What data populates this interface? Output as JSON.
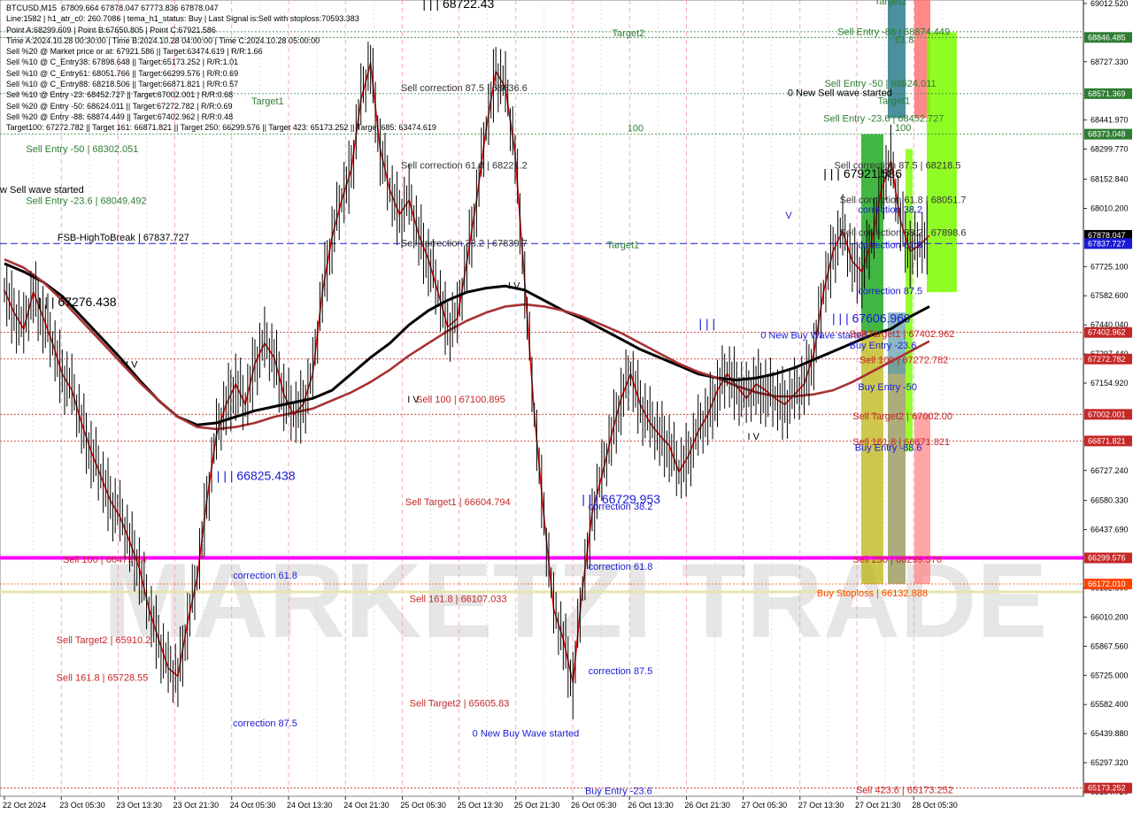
{
  "chart_data": {
    "type": "candlestick",
    "symbol": "BTCUSD,M15",
    "info_lines": [
      "BTCUSD,M15  67809.664 67878.047 67773.836 67878.047",
      "Line:1582 | h1_atr_c0: 260.7086 | tema_h1_status: Buy | Last Signal is:Sell with stoploss:70593.383",
      "Point A:68299.609 | Point B:67650.805 | Point C:67921.586",
      "Time A:2024.10.28 00:30:00 | Time B:2024.10.28 04:00:00 | Time C:2024.10.28 05:00:00",
      "Sell %20 @ Market price or at: 67921.586 || Target:63474.619 | R/R:1.66",
      "Sell %10 @ C_Entry38: 67898.648 || Target:65173.252 | R/R:1.01",
      "Sell %10 @ C_Entry61: 68051.766 || Target:66299.576 | R/R:0.69",
      "Sell %10 @ C_Entry88: 68218.506 || Target:66871.821 | R/R:0.57",
      "Sell %10 @ Entry -23: 68452.727 || Target:67002.001 | R/R:0.68",
      "Sell %20 @ Entry -50: 68624.011 || Target:67272.782 | R/R:0.69",
      "Sell %20 @ Entry -88: 68874.449 || Target:67402.962 | R/R:0.48",
      "Target100: 67272.782 || Target 161: 66871.821 || Target 250: 66299.576 || Target 423: 65173.252 || Target 685: 63474.619"
    ],
    "y_ticks": [
      "69012.520",
      "68727.330",
      "68441.970",
      "68299.770",
      "68152.840",
      "68010.200",
      "67725.100",
      "67582.600",
      "67440.040",
      "67297.440",
      "67154.920",
      "66869.240",
      "66727.240",
      "66580.330",
      "66437.690",
      "66152.800",
      "66010.200",
      "65867.560",
      "65725.000",
      "65582.400",
      "65439.880",
      "65297.320",
      "65154.720"
    ],
    "ylim": [
      65132.95,
      69029.62
    ],
    "x_ticks": [
      "22 Oct 2024",
      "23 Oct 05:30",
      "23 Oct 13:30",
      "23 Oct 21:30",
      "24 Oct 05:30",
      "24 Oct 13:30",
      "24 Oct 21:30",
      "25 Oct 05:30",
      "25 Oct 13:30",
      "25 Oct 21:30",
      "26 Oct 05:30",
      "26 Oct 13:30",
      "26 Oct 21:30",
      "27 Oct 05:30",
      "27 Oct 13:30",
      "27 Oct 21:30",
      "28 Oct 05:30"
    ],
    "price_tags": [
      {
        "label": "68846.485",
        "value": 68846.485,
        "color": "#2e7d32"
      },
      {
        "label": "68571.369",
        "value": 68571.369,
        "color": "#2e7d32"
      },
      {
        "label": "68373.048",
        "value": 68373.048,
        "color": "#2e7d32"
      },
      {
        "label": "67878.047",
        "value": 67878.047,
        "color": "#000000"
      },
      {
        "label": "67837.727",
        "value": 67837.727,
        "color": "#1a1ad6"
      },
      {
        "label": "67402.962",
        "value": 67402.962,
        "color": "#c62828"
      },
      {
        "label": "67272.782",
        "value": 67272.782,
        "color": "#c62828"
      },
      {
        "label": "67002.001",
        "value": 67002.001,
        "color": "#c62828"
      },
      {
        "label": "66871.821",
        "value": 66871.821,
        "color": "#c62828"
      },
      {
        "label": "66299.576",
        "value": 66299.576,
        "color": "#c62828"
      },
      {
        "label": "66172.010",
        "value": 66172.01,
        "color": "#ff4500"
      },
      {
        "label": "65173.252",
        "value": 65173.252,
        "color": "#c62828"
      }
    ],
    "levels": [
      {
        "value": 68874.449,
        "color": "#2e7d32",
        "style": "dot"
      },
      {
        "value": 68846.485,
        "color": "#2e7d32",
        "style": "dot"
      },
      {
        "value": 68571.369,
        "color": "#2e7d32",
        "style": "dot"
      },
      {
        "value": 68373.048,
        "color": "#2e7d32",
        "style": "dot"
      },
      {
        "value": 67837.727,
        "color": "#1a1ad6",
        "style": "dash"
      },
      {
        "value": 67402.962,
        "color": "#c62828",
        "style": "dot"
      },
      {
        "value": 67272.782,
        "color": "#c62828",
        "style": "dot"
      },
      {
        "value": 67002.001,
        "color": "#c62828",
        "style": "dot"
      },
      {
        "value": 66871.821,
        "color": "#c62828",
        "style": "dot"
      },
      {
        "value": 66299.576,
        "color": "#ff00ff",
        "style": "solid"
      },
      {
        "value": 66172.01,
        "color": "#ff4500",
        "style": "dot"
      },
      {
        "value": 66132.888,
        "color": "#e8e4b0",
        "style": "solid"
      },
      {
        "value": 65173.252,
        "color": "#c62828",
        "style": "dot"
      }
    ],
    "annotations": [
      {
        "text": "| | | 68722.43",
        "color": "#000000",
        "x": 0.39,
        "value": 68990
      },
      {
        "text": "Target2",
        "color": "#2e7d32",
        "x": 0.565,
        "value": 68852
      },
      {
        "text": "Target1",
        "color": "#2e7d32",
        "x": 0.232,
        "value": 68519
      },
      {
        "text": "100",
        "color": "#2e7d32",
        "x": 0.579,
        "value": 68387
      },
      {
        "text": "Target1",
        "color": "#2e7d32",
        "x": 0.56,
        "value": 67815
      },
      {
        "text": "Sell correction 87.5 | 68636.6",
        "color": "#333333",
        "x": 0.37,
        "value": 68583
      },
      {
        "text": "Sell correction 61.8 | 68221.2",
        "color": "#333333",
        "x": 0.37,
        "value": 68204
      },
      {
        "text": "Sell correction 38.2 | 67839.7",
        "color": "#333333",
        "x": 0.37,
        "value": 67824
      },
      {
        "text": "Sell Entry -50 | 68302.051",
        "color": "#2e7d32",
        "x": 0.024,
        "value": 68286
      },
      {
        "text": "w Sell wave started",
        "color": "#000000",
        "x": 0.0,
        "value": 68086
      },
      {
        "text": "Sell Entry -23.6 | 68049.492",
        "color": "#2e7d32",
        "x": 0.024,
        "value": 68032
      },
      {
        "text": "FSB-HighToBreak | 67837.727",
        "color": "#000000",
        "x": 0.053,
        "value": 67851
      },
      {
        "text": "| | | 67276.438",
        "color": "#000000",
        "x": 0.035,
        "value": 67532
      },
      {
        "text": "I V",
        "color": "#000000",
        "x": 0.116,
        "value": 67230
      },
      {
        "text": "I V",
        "color": "#000000",
        "x": 0.469,
        "value": 67616
      },
      {
        "text": "I V",
        "color": "#000000",
        "x": 0.376,
        "value": 67059
      },
      {
        "text": "I V",
        "color": "#000000",
        "x": 0.69,
        "value": 66877
      },
      {
        "text": "Sell 100 | 67100.895",
        "color": "#c62828",
        "x": 0.384,
        "value": 67059
      },
      {
        "text": "| | | 66825.438",
        "color": "#1a1ad6",
        "x": 0.2,
        "value": 66680
      },
      {
        "text": "Sell Target1 | 66604.794",
        "color": "#c62828",
        "x": 0.374,
        "value": 66557
      },
      {
        "text": "| | | 66729.953",
        "color": "#1a1ad6",
        "x": 0.537,
        "value": 66565
      },
      {
        "text": "correction 38.2",
        "color": "#1a1ad6",
        "x": 0.543,
        "value": 66535
      },
      {
        "text": "Sell 100 | 66479.14",
        "color": "#c62828",
        "x": 0.058,
        "value": 66275
      },
      {
        "text": "correction 61.8",
        "color": "#1a1ad6",
        "x": 0.215,
        "value": 66198
      },
      {
        "text": "correction 61.8",
        "color": "#1a1ad6",
        "x": 0.543,
        "value": 66242
      },
      {
        "text": "Sell 161.8 | 66107.033",
        "color": "#c62828",
        "x": 0.378,
        "value": 66084
      },
      {
        "text": "Sell Target2 | 65910.2",
        "color": "#c62828",
        "x": 0.052,
        "value": 65883
      },
      {
        "text": "Sell 161.8 | 65728.55",
        "color": "#c62828",
        "x": 0.052,
        "value": 65697
      },
      {
        "text": "correction 87.5",
        "color": "#1a1ad6",
        "x": 0.543,
        "value": 65730
      },
      {
        "text": "Sell Target2 | 65605.83",
        "color": "#c62828",
        "x": 0.378,
        "value": 65573
      },
      {
        "text": "correction 87.5",
        "color": "#1a1ad6",
        "x": 0.215,
        "value": 65475
      },
      {
        "text": "0 New Buy Wave started",
        "color": "#1a1ad6",
        "x": 0.436,
        "value": 65426
      },
      {
        "text": "Buy Entry -23.6",
        "color": "#1a1ad6",
        "x": 0.54,
        "value": 65143
      },
      {
        "text": "| | |",
        "color": "#1a1ad6",
        "x": 0.645,
        "value": 67425
      },
      {
        "text": "0 New Buy Wave started",
        "color": "#1a1ad6",
        "x": 0.702,
        "value": 67373
      },
      {
        "text": "V",
        "color": "#1a1ad6",
        "x": 0.725,
        "value": 67960
      },
      {
        "text": "| | | 67606.969",
        "color": "#1a1ad6",
        "x": 0.768,
        "value": 67452
      },
      {
        "text": "0 New Sell wave started",
        "color": "#000000",
        "x": 0.727,
        "value": 68560
      },
      {
        "text": "| | | 67921.586",
        "color": "#000000",
        "x": 0.76,
        "value": 68159
      },
      {
        "text": "Sell Entry -88 | 68874.449",
        "color": "#2e7d32",
        "x": 0.773,
        "value": 68859
      },
      {
        "text": "Sell Entry -50 | 68624.011",
        "color": "#2e7d32",
        "x": 0.761,
        "value": 68606
      },
      {
        "text": "Sell Entry -23.6 | 68452.727",
        "color": "#2e7d32",
        "x": 0.76,
        "value": 68434
      },
      {
        "text": "Sell correction 87.5 | 68218.5",
        "color": "#333333",
        "x": 0.77,
        "value": 68205
      },
      {
        "text": "Sell correction 61.8 | 68051.7",
        "color": "#333333",
        "x": 0.775,
        "value": 68036
      },
      {
        "text": "correction 38.2",
        "color": "#1a1ad6",
        "x": 0.792,
        "value": 67988
      },
      {
        "text": "Sell correction 38.2 | 67898.6",
        "color": "#333333",
        "x": 0.775,
        "value": 67875
      },
      {
        "text": "correction 61.8",
        "color": "#1a1ad6",
        "x": 0.792,
        "value": 67816
      },
      {
        "text": "correction 87.5",
        "color": "#1a1ad6",
        "x": 0.792,
        "value": 67590
      },
      {
        "text": "Sell Target1 | 67402.962",
        "color": "#c62828",
        "x": 0.784,
        "value": 67381
      },
      {
        "text": "Buy Entry -23.6",
        "color": "#1a1ad6",
        "x": 0.784,
        "value": 67323
      },
      {
        "text": "Sell 100 | 67272.782",
        "color": "#c62828",
        "x": 0.793,
        "value": 67253
      },
      {
        "text": "Buy Entry -50",
        "color": "#1a1ad6",
        "x": 0.792,
        "value": 67120
      },
      {
        "text": "Sell Target2 | 67002.00",
        "color": "#c62828",
        "x": 0.787,
        "value": 66978
      },
      {
        "text": "Sell 161.8 | 66871.821",
        "color": "#c62828",
        "x": 0.787,
        "value": 66852
      },
      {
        "text": "Buy Entry -88.6",
        "color": "#1a1ad6",
        "x": 0.789,
        "value": 66824
      },
      {
        "text": "Sell 250 | 66299.576",
        "color": "#c62828",
        "x": 0.787,
        "value": 66275
      },
      {
        "text": "Buy Stoploss | 66132.888",
        "color": "#ff4500",
        "x": 0.754,
        "value": 66112
      },
      {
        "text": "Sell 423.6 | 65173.252",
        "color": "#c62828",
        "x": 0.79,
        "value": 65149
      },
      {
        "text": "Target2",
        "color": "#2e7d32",
        "x": 0.807,
        "value": 69007
      },
      {
        "text": "100",
        "color": "#2e7d32",
        "x": 0.826,
        "value": 68388
      },
      {
        "text": "Target1",
        "color": "#2e7d32",
        "x": 0.81,
        "value": 68520
      },
      {
        "text": "61.8",
        "color": "#2e7d32",
        "x": 0.826,
        "value": 68820
      }
    ],
    "grid": true,
    "watermark": "MARKETZI TRADE",
    "series": [
      {
        "name": "price",
        "values": [
          67610,
          67500,
          67420,
          67600,
          67480,
          67350,
          67200,
          67120,
          66960,
          66820,
          66700,
          66580,
          66500,
          66380,
          66250,
          66050,
          65900,
          65760,
          65720,
          65980,
          66200,
          66580,
          66900,
          67050,
          67150,
          67050,
          67250,
          67350,
          67280,
          67100,
          67000,
          67050,
          67200,
          67600,
          67870,
          68050,
          68200,
          68540,
          68720,
          68300,
          68100,
          67980,
          68050,
          67880,
          67760,
          67600,
          67430,
          67470,
          67750,
          68050,
          68400,
          68680,
          68600,
          68280,
          67650,
          67000,
          66500,
          66050,
          65900,
          65690,
          66150,
          66520,
          66700,
          66900,
          67080,
          67200,
          67050,
          66960,
          66900,
          66850,
          66720,
          66800,
          66920,
          67000,
          67120,
          67200,
          67140,
          67080,
          67150,
          67120,
          67080,
          67050,
          67100,
          67150,
          67300,
          67600,
          67800,
          67900,
          67750,
          67700,
          67850,
          68100,
          68240,
          67950,
          67800,
          67830,
          67878
        ]
      },
      {
        "name": "ma-black",
        "values": [
          67740,
          67700,
          67650,
          67580,
          67480,
          67380,
          67280,
          67170,
          67070,
          66990,
          66950,
          66960,
          66990,
          67020,
          67040,
          67060,
          67080,
          67120,
          67200,
          67280,
          67350,
          67440,
          67510,
          67560,
          67600,
          67620,
          67630,
          67610,
          67560,
          67510,
          67470,
          67420,
          67370,
          67320,
          67280,
          67240,
          67200,
          67180,
          67170,
          67180,
          67200,
          67230,
          67270,
          67310,
          67350,
          67390,
          67420,
          67480,
          67530
        ]
      },
      {
        "name": "ma-darkred",
        "values": [
          67760,
          67720,
          67650,
          67560,
          67460,
          67360,
          67260,
          67160,
          67070,
          66990,
          66940,
          66930,
          66940,
          66960,
          66990,
          67010,
          67030,
          67070,
          67110,
          67160,
          67220,
          67290,
          67350,
          67410,
          67460,
          67500,
          67530,
          67540,
          67530,
          67510,
          67480,
          67440,
          67400,
          67350,
          67300,
          67250,
          67210,
          67180,
          67140,
          67110,
          67090,
          67090,
          67100,
          67120,
          67160,
          67210,
          67260,
          67310,
          67360
        ]
      }
    ]
  }
}
